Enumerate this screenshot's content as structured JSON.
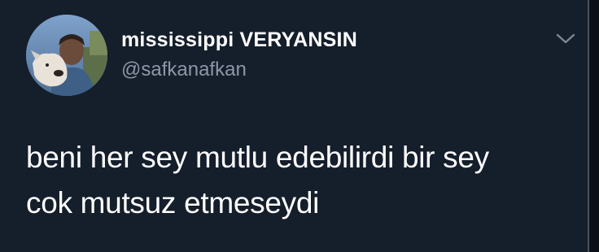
{
  "tweet": {
    "display_name": "mississippi VERYANSIN",
    "handle": "@safkanafkan",
    "text_line_1": "beni her sey mutlu edebilirdi bir sey",
    "text_line_2": "cok mutsuz etmeseydi"
  },
  "icons": {
    "menu": "chevron-down-icon",
    "avatar": "profile-photo"
  },
  "colors": {
    "background": "#151e2b",
    "name": "#ffffff",
    "handle": "#8c98a7",
    "text": "#ffffff"
  }
}
